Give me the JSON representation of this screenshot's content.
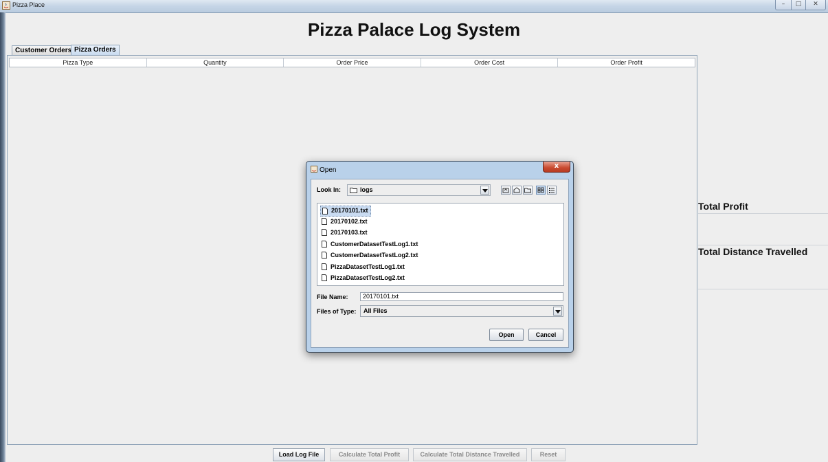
{
  "window": {
    "title": "Pizza Place",
    "controls": {
      "minimize": "–",
      "maximize": "□",
      "close": "✕"
    }
  },
  "header": {
    "title": "Pizza Palace Log System"
  },
  "tabs": [
    {
      "label": "Customer Orders",
      "selected": false
    },
    {
      "label": "Pizza Orders",
      "selected": true
    }
  ],
  "table": {
    "columns": [
      "Pizza Type",
      "Quantity",
      "Order Price",
      "Order Cost",
      "Order Profit"
    ],
    "rows": []
  },
  "side": {
    "total_profit_label": "Total Profit",
    "total_distance_label": "Total Distance Travelled"
  },
  "buttons": {
    "load": "Load Log File",
    "calc_profit": "Calculate Total Profit",
    "calc_distance": "Calculate Total Distance Travelled",
    "reset": "Reset"
  },
  "dialog": {
    "title": "Open",
    "close": "x",
    "look_in_label": "Look In:",
    "look_in_value": "logs",
    "files": [
      "20170101.txt",
      "20170102.txt",
      "20170103.txt",
      "CustomerDatasetTestLog1.txt",
      "CustomerDatasetTestLog2.txt",
      "PizzaDatasetTestLog1.txt",
      "PizzaDatasetTestLog2.txt"
    ],
    "selected_file": "20170101.txt",
    "file_name_label": "File Name:",
    "file_name_value": "20170101.txt",
    "files_of_type_label": "Files of Type:",
    "files_of_type_value": "All Files",
    "open_button": "Open",
    "cancel_button": "Cancel"
  }
}
